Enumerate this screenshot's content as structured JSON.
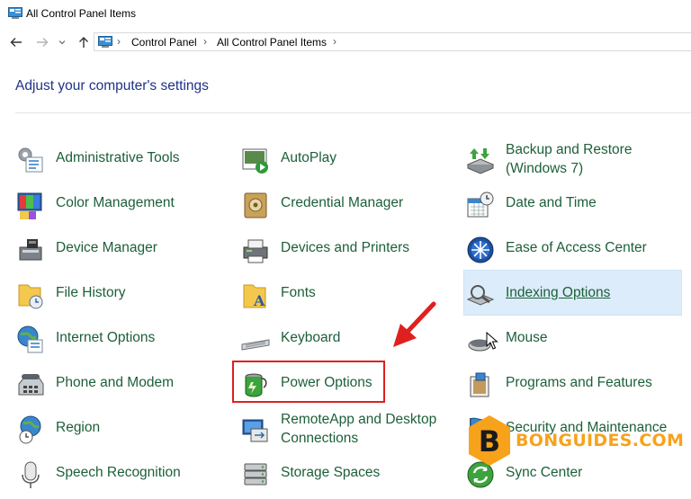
{
  "window": {
    "title": "All Control Panel Items"
  },
  "breadcrumb": [
    "Control Panel",
    "All Control Panel Items"
  ],
  "heading": "Adjust your computer's settings",
  "items": {
    "administrative_tools": "Administrative Tools",
    "autoplay": "AutoPlay",
    "backup_restore_line1": "Backup and Restore",
    "backup_restore_line2": "(Windows 7)",
    "color_management": "Color Management",
    "credential_manager": "Credential Manager",
    "date_time": "Date and Time",
    "device_manager": "Device Manager",
    "devices_printers": "Devices and Printers",
    "ease_of_access": "Ease of Access Center",
    "file_history": "File History",
    "fonts": "Fonts",
    "indexing_options": "Indexing Options",
    "internet_options": "Internet Options",
    "keyboard": "Keyboard",
    "mouse": "Mouse",
    "phone_modem": "Phone and Modem",
    "power_options": "Power Options",
    "programs_features": "Programs and Features",
    "region": "Region",
    "remoteapp_line1": "RemoteApp and Desktop",
    "remoteapp_line2": "Connections",
    "security_maintenance": "Security and Maintenance",
    "speech_recognition": "Speech Recognition",
    "storage_spaces": "Storage Spaces",
    "sync_center": "Sync Center"
  },
  "watermark": {
    "letter": "B",
    "text": "BONGUIDES.COM"
  },
  "colors": {
    "link": "#1c5f38",
    "heading": "#1e3287",
    "highlight": "#dcecfa",
    "annotation": "#e02020",
    "watermark": "#f7a21b"
  }
}
